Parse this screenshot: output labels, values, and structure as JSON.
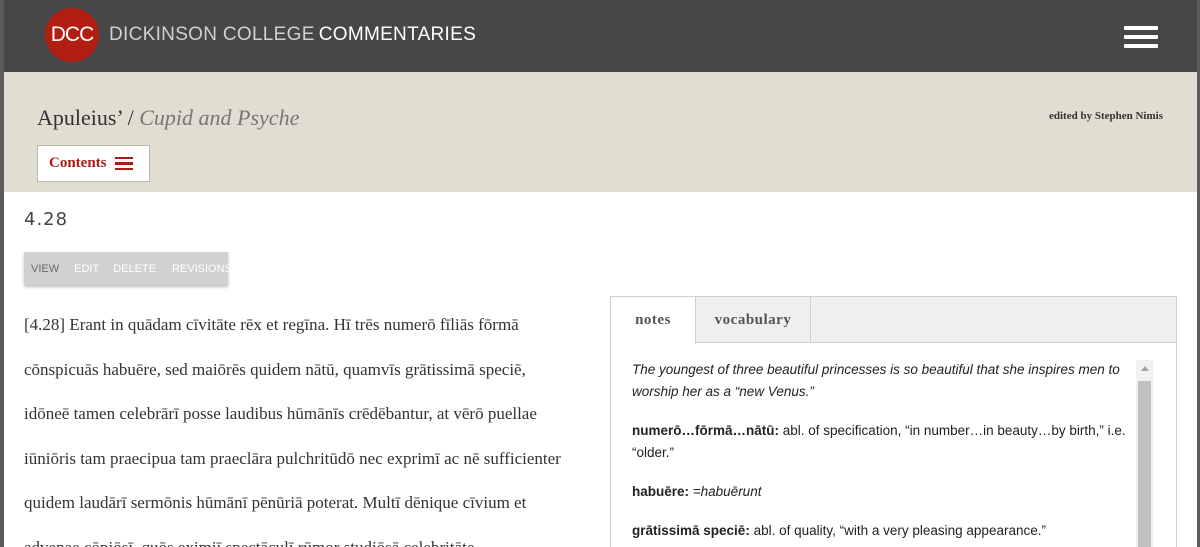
{
  "header": {
    "logo": "DCC",
    "site_title_part1": "DICKINSON COLLEGE",
    "site_title_part2": "COMMENTARIES"
  },
  "banner": {
    "author": "Apuleius’ / ",
    "work": "Cupid and Psyche",
    "editor": "edited by Stephen Nimis",
    "contents_label": "Contents"
  },
  "section": {
    "number": "4.28",
    "tabs": [
      "VIEW",
      "EDIT",
      "DELETE",
      "REVISIONS"
    ]
  },
  "text": {
    "lines": [
      "[4.28] Erant in quādam cīvitāte rēx et regīna. Hī trēs numerō fīliās fōrmā",
      "cōnspicuās habuēre, sed maiōrēs quidem nātū, quamvīs grātissimā speciē,",
      "idōneē tamen celebrārī posse laudibus hūmānīs crēdēbantur, at vērō puellae",
      "iūniōris tam praecipua tam praeclāra pulchritūdō nec exprimī ac nē sufficienter",
      "quidem laudārī sermōnis hūmānī pēnūriā poterat. Multī dēnique cīvium et",
      "advenae cōpiōsī, quōs eximiī spectāculī rūmor studiōsā celebritāte"
    ]
  },
  "panel": {
    "tabs": [
      "notes",
      "vocabulary"
    ],
    "notes": {
      "intro": "The youngest of three beautiful princesses is so beautiful that she inspires men to worship her as a “new Venus.”",
      "items": [
        {
          "term": "numerō…fōrmā…nātū:",
          "text": " abl. of specification, “in number…in beauty…by birth,” i.e. “older.”"
        },
        {
          "term": "habuēre:",
          "text": " =habuērunt"
        },
        {
          "term": "grātissimā speciē:",
          "text": " abl. of quality, “with a very pleasing appearance.”"
        }
      ]
    }
  }
}
